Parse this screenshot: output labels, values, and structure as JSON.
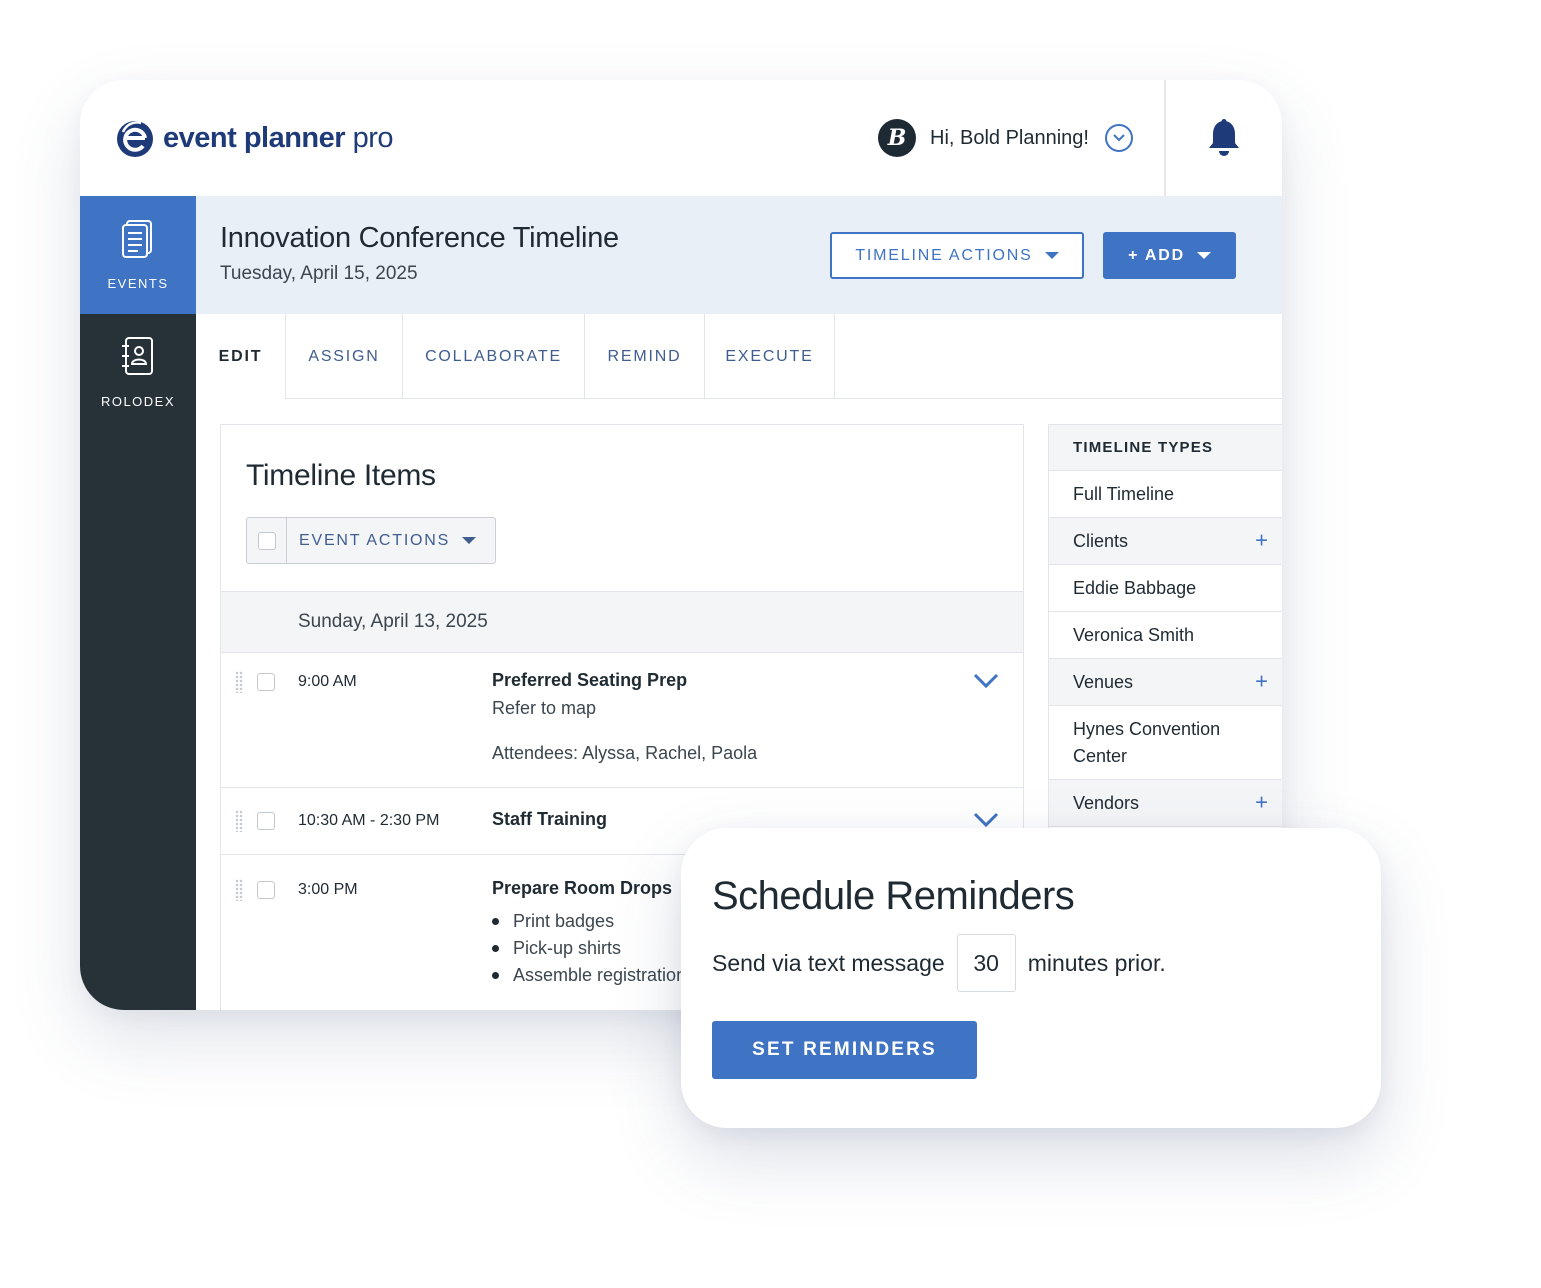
{
  "brand": {
    "logo_bold": "event planner",
    "logo_light": " pro"
  },
  "header": {
    "avatar_letter": "B",
    "greeting": "Hi, Bold Planning!"
  },
  "sidebar": {
    "items": [
      {
        "label": "EVENTS",
        "icon": "document-icon",
        "active": true
      },
      {
        "label": "ROLODEX",
        "icon": "contact-book-icon",
        "active": false
      }
    ]
  },
  "page": {
    "title": "Innovation Conference Timeline",
    "date": "Tuesday, April 15, 2025",
    "timeline_actions_label": "TIMELINE ACTIONS",
    "add_label": "+ ADD"
  },
  "tabs": [
    {
      "label": "EDIT",
      "active": true
    },
    {
      "label": "ASSIGN"
    },
    {
      "label": "COLLABORATE"
    },
    {
      "label": "REMIND"
    },
    {
      "label": "EXECUTE"
    }
  ],
  "timeline": {
    "title": "Timeline Items",
    "event_actions_label": "EVENT ACTIONS",
    "date_header": "Sunday, April 13, 2025",
    "items": [
      {
        "time": "9:00 AM",
        "title": "Preferred Seating Prep",
        "note": "Refer to map",
        "attendees": "Attendees: Alyssa, Rachel, Paola"
      },
      {
        "time": "10:30 AM - 2:30 PM",
        "title": "Staff Training"
      },
      {
        "time": "3:00 PM",
        "title": "Prepare Room Drops",
        "bullets": [
          "Print badges",
          "Pick-up shirts",
          "Assemble registration"
        ]
      }
    ]
  },
  "timeline_types": {
    "header": "TIMELINE TYPES",
    "rows": [
      {
        "label": "Full Timeline"
      },
      {
        "label": "Clients",
        "plus": "+"
      },
      {
        "label": "Eddie Babbage"
      },
      {
        "label": "Veronica Smith"
      },
      {
        "label": "Venues",
        "plus": "+"
      },
      {
        "label": "Hynes Convention Center"
      },
      {
        "label": "Vendors",
        "plus": "+"
      }
    ]
  },
  "reminders": {
    "title": "Schedule Reminders",
    "prefix": "Send via text message",
    "minutes": "30",
    "suffix": "minutes prior.",
    "button": "SET REMINDERS"
  },
  "colors": {
    "accent": "#3f73c3",
    "sidebar": "#263138",
    "header_band": "#e9eff7",
    "brand": "#1e3a78"
  }
}
